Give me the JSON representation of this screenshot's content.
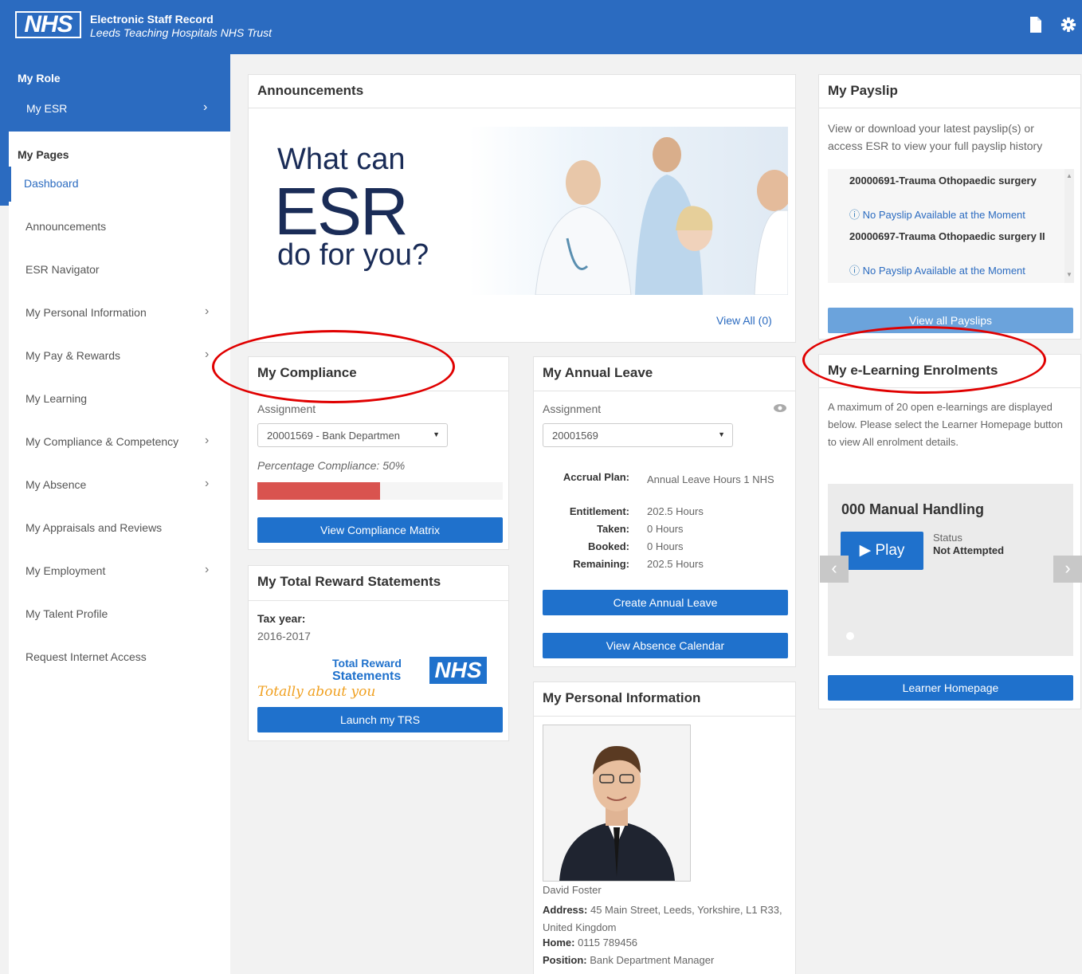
{
  "header": {
    "logo_text": "NHS",
    "title": "Electronic Staff Record",
    "subtitle": "Leeds Teaching Hospitals NHS Trust",
    "icons": [
      "document-icon",
      "gear-icon"
    ]
  },
  "sidebar": {
    "role_title": "My Role",
    "role_item": "My ESR",
    "pages_title": "My Pages",
    "items": [
      {
        "label": "Dashboard",
        "chevron": false
      },
      {
        "label": "Announcements",
        "chevron": false
      },
      {
        "label": "ESR Navigator",
        "chevron": false
      },
      {
        "label": "My Personal Information",
        "chevron": true
      },
      {
        "label": "My Pay & Rewards",
        "chevron": true
      },
      {
        "label": "My Learning",
        "chevron": false
      },
      {
        "label": "My Compliance & Competency",
        "chevron": true
      },
      {
        "label": "My Absence",
        "chevron": true
      },
      {
        "label": "My Appraisals and Reviews",
        "chevron": false
      },
      {
        "label": "My Employment",
        "chevron": true
      },
      {
        "label": "My Talent Profile",
        "chevron": false
      },
      {
        "label": "Request Internet Access",
        "chevron": false
      }
    ]
  },
  "announcements": {
    "title": "Announcements",
    "banner_line1": "What can",
    "banner_line2": "ESR",
    "banner_line3": "do for you?",
    "view_all": "View All (0)"
  },
  "payslip": {
    "title": "My Payslip",
    "description": "View or download your latest payslip(s) or access ESR to view your full payslip history",
    "entries": [
      {
        "name": "20000691-Trauma Othopaedic surgery",
        "status": "No Payslip Available at the Moment"
      },
      {
        "name": "20000697-Trauma Othopaedic surgery II",
        "status": "No Payslip Available at the Moment"
      }
    ],
    "button": "View all Payslips"
  },
  "compliance": {
    "title": "My Compliance",
    "assignment_label": "Assignment",
    "assignment_value": "20001569 - Bank Departmen",
    "percentage_text": "Percentage Compliance: 50%",
    "percentage": 50,
    "button": "View Compliance Matrix"
  },
  "annual_leave": {
    "title": "My Annual Leave",
    "assignment_label": "Assignment",
    "assignment_value": "20001569",
    "accrual_label": "Accrual Plan:",
    "accrual_value": "Annual Leave Hours 1 NHS",
    "entitlement_label": "Entitlement:",
    "entitlement_value": "202.5 Hours",
    "taken_label": "Taken:",
    "taken_value": "0 Hours",
    "booked_label": "Booked:",
    "booked_value": "0 Hours",
    "remaining_label": "Remaining:",
    "remaining_value": "202.5 Hours",
    "create_button": "Create Annual Leave",
    "calendar_button": "View Absence Calendar"
  },
  "elearning": {
    "title": "My e-Learning Enrolments",
    "description": "A maximum of 20 open e-learnings are displayed below. Please select the Learner Homepage button to view All enrolment details.",
    "course_title": "000 Manual Handling",
    "play_label": "Play",
    "status_label": "Status",
    "status_value": "Not Attempted",
    "button": "Learner Homepage"
  },
  "total_reward": {
    "title": "My Total Reward Statements",
    "tax_year_label": "Tax year:",
    "tax_year_value": "2016-2017",
    "logo_line1": "Total Reward",
    "logo_line2": "Statements",
    "logo_tagline": "Totally about you",
    "logo_nhs": "NHS",
    "button": "Launch my TRS"
  },
  "personal_info": {
    "title": "My Personal Information",
    "name": "David Foster",
    "address_label": "Address:",
    "address_value": "45 Main Street, Leeds, Yorkshire, L1 R33, United Kingdom",
    "home_label": "Home:",
    "home_value": "0115 789456",
    "position_label": "Position:",
    "position_value": "Bank Department Manager"
  },
  "colors": {
    "brand_blue": "#2b6bc0",
    "button_blue": "#1f71cc",
    "progress_red": "#d9534f",
    "annotation_red": "#e00000"
  }
}
